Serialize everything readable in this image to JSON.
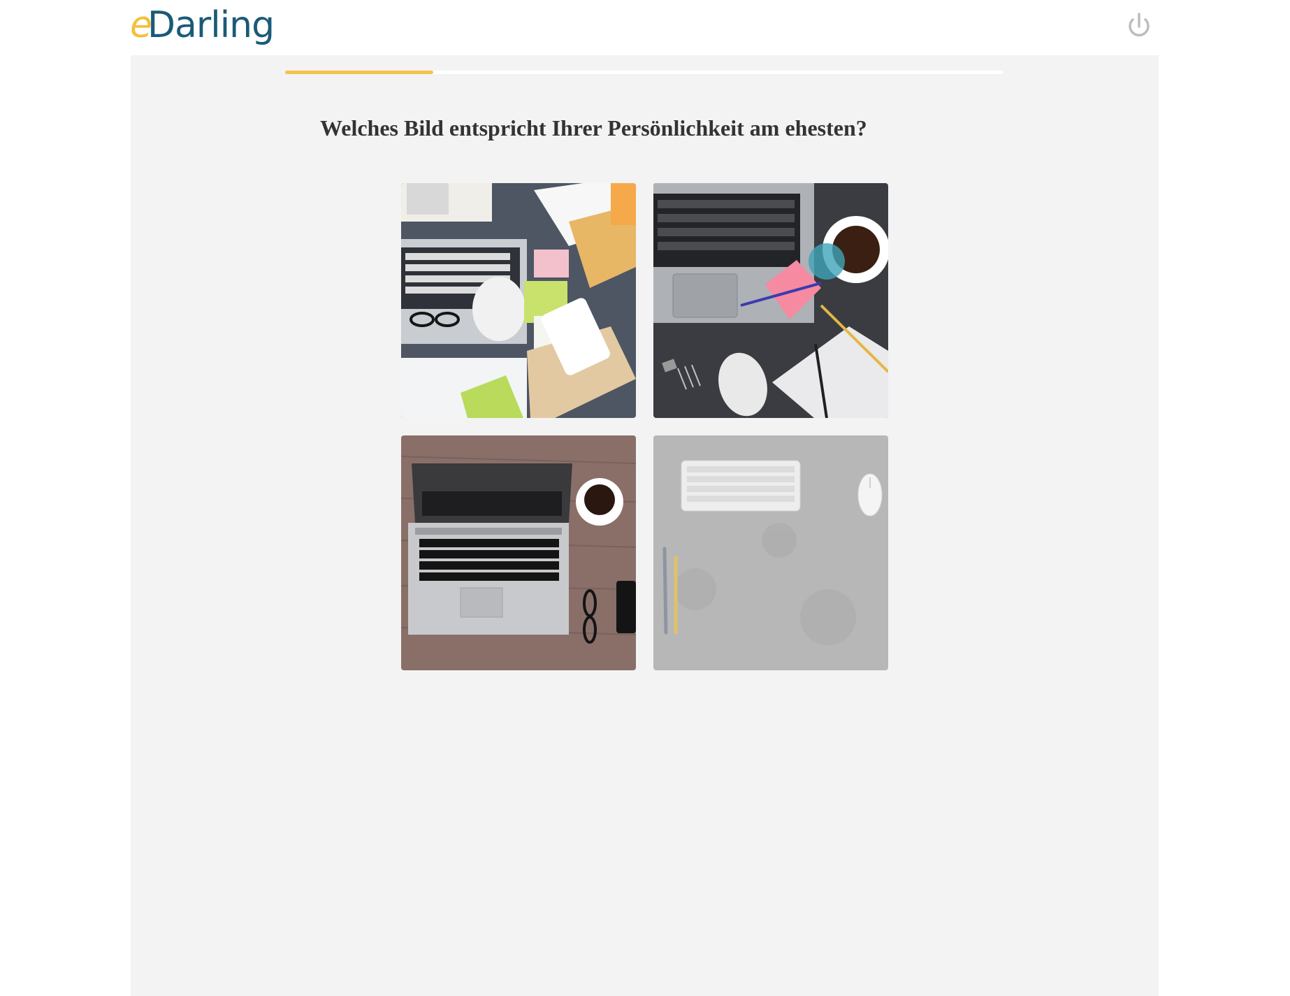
{
  "header": {
    "logo": {
      "prefix": "e",
      "rest": "Darling"
    },
    "logout_icon": "power-icon"
  },
  "quiz": {
    "progress_percent": 20.6,
    "question": "Welches Bild entspricht Ihrer Persönlichkeit am ehesten?",
    "options": [
      {
        "icon": "desk-photo-cluttered"
      },
      {
        "icon": "desk-photo-dark-coffee"
      },
      {
        "icon": "desk-photo-wooden-laptop"
      },
      {
        "icon": "desk-photo-minimal-keyboard"
      }
    ]
  },
  "colors": {
    "accent": "#f7c24a",
    "brand": "#1a5a78",
    "panel_bg": "#f3f3f3",
    "text": "#333333"
  }
}
